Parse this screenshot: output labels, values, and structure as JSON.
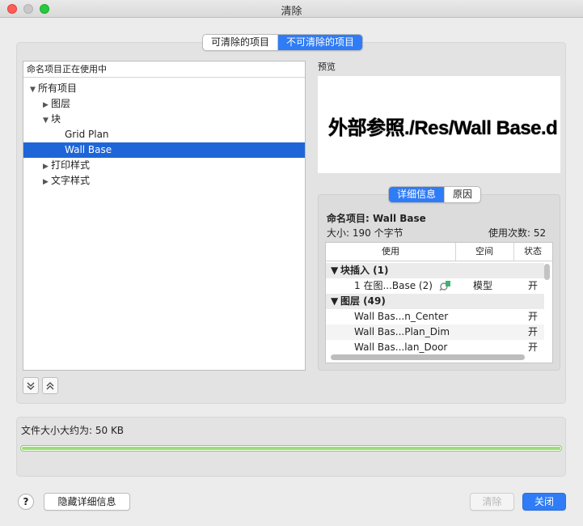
{
  "window": {
    "title": "清除"
  },
  "tabs": {
    "purgeable": "可清除的项目",
    "non_purgeable": "不可清除的项目",
    "selected": "non_purgeable"
  },
  "tree": {
    "header": "命名项目正在使用中",
    "items": [
      {
        "label": "所有项目",
        "expanded": true
      },
      {
        "label": "图层",
        "expanded": false
      },
      {
        "label": "块",
        "expanded": true
      },
      {
        "label": "Grid Plan"
      },
      {
        "label": "Wall Base",
        "selected": true
      },
      {
        "label": "打印样式",
        "expanded": false
      },
      {
        "label": "文字样式",
        "expanded": false
      }
    ]
  },
  "preview": {
    "label": "预览",
    "text": "外部参照./Res/Wall Base.d"
  },
  "detail_tabs": {
    "details": "详细信息",
    "reason": "原因",
    "selected": "details"
  },
  "details": {
    "named_item": "命名项目: Wall Base",
    "size": "大小: 190 个字节",
    "usage_count": "使用次数: 52",
    "columns": [
      "使用",
      "空间",
      "状态"
    ],
    "rows": [
      {
        "group": true,
        "label": "块插入 (1)"
      },
      {
        "label": "1 在图...Base (2)",
        "space": "模型",
        "state": "开"
      },
      {
        "group": true,
        "label": "图层 (49)"
      },
      {
        "label": "Wall Bas...n_Center",
        "space": "",
        "state": "开"
      },
      {
        "label": "Wall Bas...Plan_Dim",
        "space": "",
        "state": "开"
      },
      {
        "label": "Wall Bas...lan_Door",
        "space": "",
        "state": "开"
      }
    ]
  },
  "file_size": {
    "label": "文件大小大约为: 50 KB",
    "progress": 1.0
  },
  "buttons": {
    "help": "?",
    "hide_details": "隐藏详细信息",
    "purge": "清除",
    "close": "关闭"
  },
  "icons": {
    "expand_all": "expand-all-icon",
    "collapse_all": "collapse-all-icon",
    "zoom_to": "zoom-locate-icon"
  },
  "colors": {
    "accent": "#2f7cf6",
    "selection": "#1e66d8",
    "progress": "#9ddc7a"
  }
}
